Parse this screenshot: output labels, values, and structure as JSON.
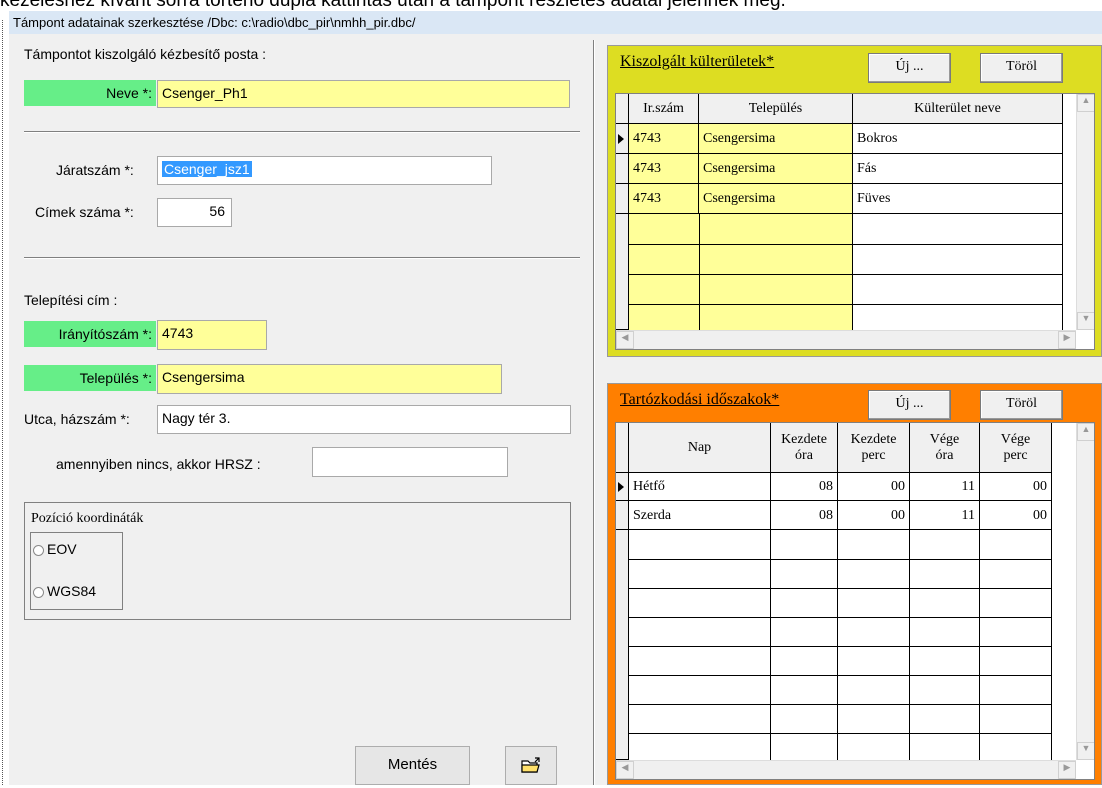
{
  "caption": "kezeléshez kívánt sorra történő dupla kattintás után a támpont részletes adatai jelennek meg.",
  "window": {
    "title": "Támpont adatainak szerkesztése  /Dbc: c:\\radio\\dbc_pir\\nmhh_pir.dbc/"
  },
  "form": {
    "section_post": "Támpontot kiszolgáló kézbesítő posta :",
    "name_label": "Neve *:",
    "name_value": "Csenger_Ph1",
    "route_label": "Járatszám *:",
    "route_value": "Csenger_jsz1",
    "addr_count_label": "Címek száma *:",
    "addr_count_value": "56",
    "install_addr_label": "Telepítési cím :",
    "zip_label": "Irányítószám *:",
    "zip_value": "4743",
    "town_label": "Település *:",
    "town_value": "Csengersima",
    "street_label": "Utca, házszám *:",
    "street_value": "Nagy tér 3.",
    "hrsz_label": "amennyiben nincs, akkor HRSZ :",
    "hrsz_value": "",
    "position_group": "Pozíció koordináták",
    "radio_eov": "EOV",
    "radio_wgs": "WGS84",
    "save_button": "Mentés",
    "folder_icon": "folder-open-icon"
  },
  "areas_panel": {
    "title": "Kiszolgált külterületek*",
    "new_button": "Új ...",
    "delete_button": "Töröl",
    "columns": [
      "Ir.szám",
      "Település",
      "Külterület neve"
    ],
    "rows": [
      [
        "4743",
        "Csengersima",
        "Bokros"
      ],
      [
        "4743",
        "Csengersima",
        "Fás"
      ],
      [
        "4743",
        "Csengersima",
        "Füves"
      ]
    ],
    "color": "#dddd22"
  },
  "periods_panel": {
    "title": "Tartózkodási időszakok*",
    "new_button": "Új ...",
    "delete_button": "Töröl",
    "columns": [
      "Nap",
      "Kezdete óra",
      "Kezdete perc",
      "Vége óra",
      "Vége perc"
    ],
    "rows": [
      [
        "Hétfő",
        "08",
        "00",
        "11",
        "00"
      ],
      [
        "Szerda",
        "08",
        "00",
        "11",
        "00"
      ]
    ],
    "color": "#ff7f00"
  }
}
